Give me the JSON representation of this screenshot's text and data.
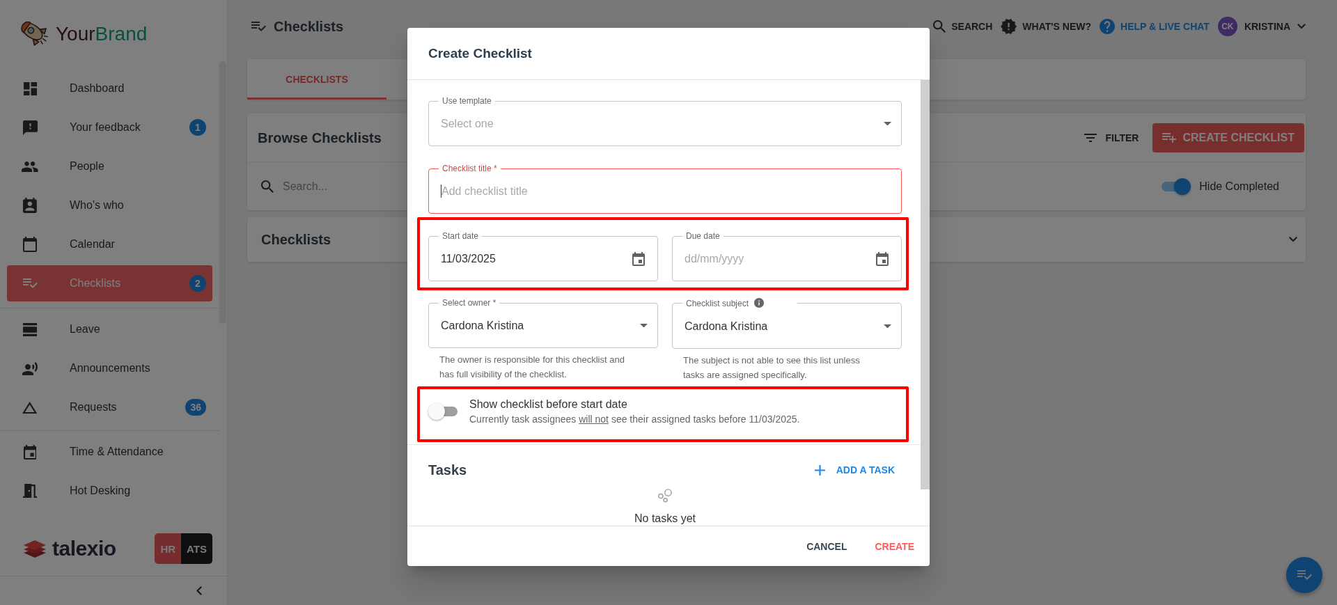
{
  "sidebar": {
    "logo": [
      "Your",
      "Brand"
    ],
    "groups": [
      {
        "items": [
          {
            "label": "Dashboard",
            "selected": false
          },
          {
            "label": "Your feedback",
            "badge": "1",
            "selected": false
          },
          {
            "label": "People",
            "selected": false
          },
          {
            "label": "Who's who",
            "selected": false
          },
          {
            "label": "Calendar",
            "selected": false
          },
          {
            "label": "Checklists",
            "badge": "2",
            "selected": true
          }
        ]
      },
      {
        "items": [
          {
            "label": "Leave",
            "selected": false
          },
          {
            "label": "Announcements",
            "selected": false
          },
          {
            "label": "Requests",
            "badge": "36",
            "selected": false
          }
        ]
      },
      {
        "items": [
          {
            "label": "Time & Attendance",
            "selected": false
          },
          {
            "label": "Hot Desking",
            "selected": false
          }
        ]
      }
    ],
    "product": "talexio",
    "modules": [
      {
        "label": "HR",
        "selected": true
      },
      {
        "label": "ATS",
        "selected": false
      }
    ]
  },
  "header": {
    "title": "Checklists",
    "actions": [
      {
        "label": "SEARCH",
        "kind": "plain"
      },
      {
        "label": "WHAT'S NEW?",
        "kind": "plain"
      },
      {
        "label": "HELP & LIVE CHAT",
        "kind": "link"
      }
    ],
    "user": {
      "initials": "CK",
      "name": "KRISTINA"
    }
  },
  "tabs": [
    {
      "label": "CHECKLISTS",
      "selected": true
    }
  ],
  "browse": {
    "title": "Browse Checklists",
    "filter": "FILTER",
    "create": "CREATE CHECKLIST",
    "search": {
      "placeholder": "Search..."
    },
    "hide_completed": {
      "label": "Hide Completed",
      "on": true
    }
  },
  "checklists_panel": {
    "title": "Checklists",
    "expanded": false
  },
  "dialog": {
    "title": "Create Checklist",
    "template": {
      "label": "Use template",
      "placeholder": "Select one"
    },
    "title_field": {
      "label": "Checklist title *",
      "placeholder": "Add checklist title",
      "invalid": true,
      "focused": true
    },
    "dates": {
      "highlighted": true,
      "fields": [
        {
          "label": "Start date",
          "value": "11/03/2025"
        },
        {
          "label": "Due date",
          "placeholder": "dd/mm/yyyy"
        }
      ]
    },
    "people": [
      {
        "label": "Select owner *",
        "value": "Cardona Kristina",
        "info": false,
        "helper": "The owner is responsible for this checklist and has full visibility of the checklist."
      },
      {
        "label": "Checklist subject",
        "value": "Cardona Kristina",
        "info": true,
        "helper": "The subject is not able to see this list unless tasks are assigned specifically."
      }
    ],
    "visibility": {
      "highlighted": true,
      "on": false,
      "title": "Show checklist before start date",
      "description": {
        "before": "Currently task assignees",
        "underlined": "will not",
        "after": "see their assigned tasks before 11/03/2025."
      }
    },
    "tasks": {
      "title": "Tasks",
      "add": "ADD A TASK",
      "empty": "No tasks yet"
    },
    "buttons": [
      {
        "label": "CANCEL",
        "kind": "text"
      },
      {
        "label": "CREATE",
        "kind": "primary"
      }
    ]
  }
}
